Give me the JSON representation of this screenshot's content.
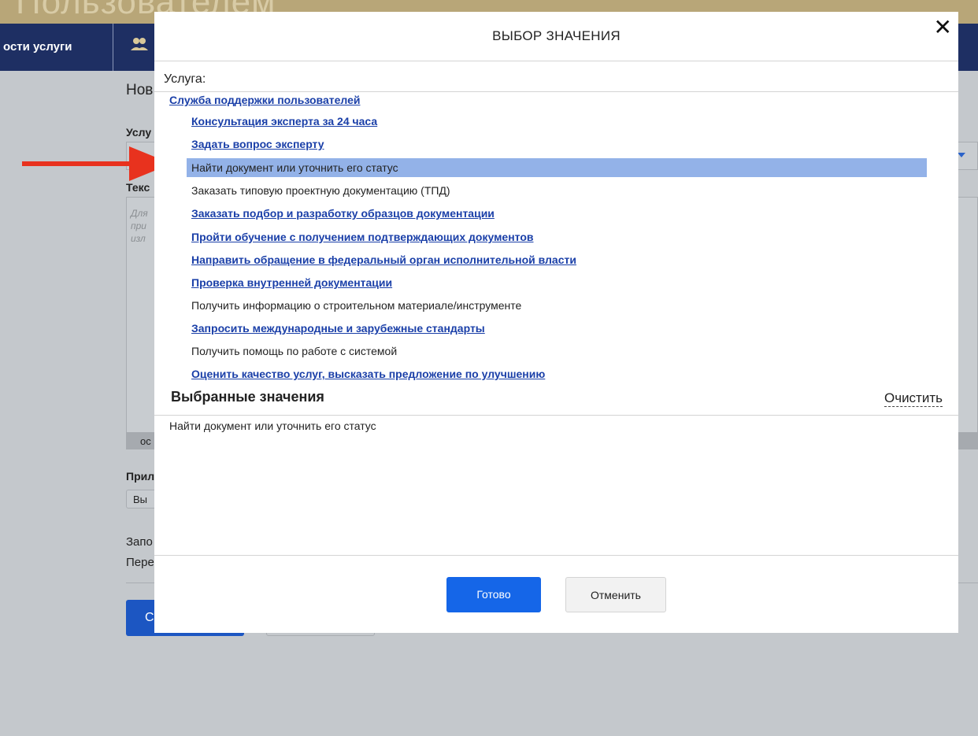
{
  "background": {
    "logo_text": "Пользователем",
    "nav_item_label": "ости услуги",
    "page_title_partial": "Нов",
    "service_label_partial": "Услу",
    "text_label_partial": "Текс",
    "textarea_placeholder_partial": [
      "Для",
      "при",
      "изл"
    ],
    "footer_partial": "ос",
    "attachments_label_partial": "Прил",
    "choose_file_partial": "Вы",
    "line1_partial": "Запо",
    "line2_partial": "Пере",
    "submit_partial": "С",
    "colors": {
      "nav": "#1e2f63",
      "top_band": "#b8a678",
      "overlay": "#c4c8cc"
    }
  },
  "modal": {
    "title": "ВЫБОР ЗНАЧЕНИЯ",
    "close_glyph": "✕",
    "field_label": "Услуга:",
    "group": "Служба поддержки пользователей",
    "items": [
      {
        "label": "Консультация эксперта за 24 часа",
        "kind": "link"
      },
      {
        "label": "Задать вопрос эксперту",
        "kind": "link"
      },
      {
        "label": "Найти документ или уточнить его статус",
        "kind": "selected"
      },
      {
        "label": "Заказать типовую проектную документацию (ТПД)",
        "kind": "plain"
      },
      {
        "label": "Заказать подбор и разработку образцов документации",
        "kind": "link"
      },
      {
        "label": "Пройти обучение с получением подтверждающих документов",
        "kind": "link"
      },
      {
        "label": "Направить обращение в федеральный орган исполнительной власти",
        "kind": "link"
      },
      {
        "label": "Проверка внутренней документации",
        "kind": "link"
      },
      {
        "label": "Получить информацию о строительном материале/инструменте",
        "kind": "plain"
      },
      {
        "label": "Запросить международные и зарубежные стандарты",
        "kind": "link"
      },
      {
        "label": "Получить помощь по работе с системой",
        "kind": "plain"
      },
      {
        "label": "Оценить качество услуг, высказать предложение по улучшению",
        "kind": "link"
      }
    ],
    "selected_title": "Выбранные значения",
    "clear_label": "Очистить",
    "selected_values": [
      "Найти документ или уточнить его статус"
    ],
    "ok_label": "Готово",
    "cancel_label": "Отменить",
    "colors": {
      "link": "#1a3fa8",
      "selected_bg": "#93b2e8",
      "primary": "#1566e8",
      "arrow": "#e8321e"
    }
  }
}
